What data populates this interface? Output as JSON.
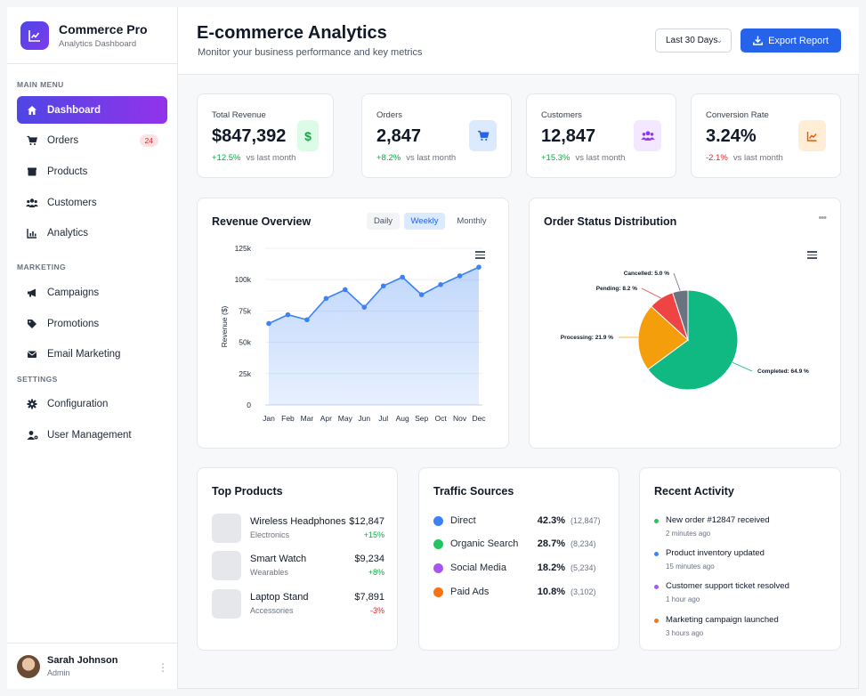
{
  "brand": {
    "title": "Commerce Pro",
    "subtitle": "Analytics Dashboard"
  },
  "sidebar": {
    "sections": [
      {
        "label": "MAIN MENU"
      },
      {
        "label": "MARKETING"
      },
      {
        "label": "SETTINGS"
      }
    ],
    "items": [
      {
        "label": "Dashboard",
        "icon": "home-icon",
        "active": true
      },
      {
        "label": "Orders",
        "icon": "cart-icon",
        "badge": "24"
      },
      {
        "label": "Products",
        "icon": "box-icon"
      },
      {
        "label": "Customers",
        "icon": "users-icon"
      },
      {
        "label": "Analytics",
        "icon": "chart-icon"
      },
      {
        "label": "Campaigns",
        "icon": "megaphone-icon"
      },
      {
        "label": "Promotions",
        "icon": "tags-icon"
      },
      {
        "label": "Email Marketing",
        "icon": "envelope-icon"
      },
      {
        "label": "Configuration",
        "icon": "gear-icon"
      },
      {
        "label": "User Management",
        "icon": "user-gear-icon"
      }
    ],
    "user": {
      "name": "Sarah Johnson",
      "role": "Admin"
    }
  },
  "header": {
    "title": "E-commerce Analytics",
    "subtitle": "Monitor your business performance and key metrics",
    "range": "Last 30 Days",
    "export_label": "Export Report"
  },
  "stats": [
    {
      "label": "Total Revenue",
      "value": "$847,392",
      "change": "+12.5%",
      "vs": "vs last month",
      "color": "#16a34a",
      "icon": "dollar-icon"
    },
    {
      "label": "Orders",
      "value": "2,847",
      "change": "+8.2%",
      "vs": "vs last month",
      "color": "#2563eb",
      "icon": "cart-icon"
    },
    {
      "label": "Customers",
      "value": "12,847",
      "change": "+15.3%",
      "vs": "vs last month",
      "color": "#9333ea",
      "icon": "users-icon"
    },
    {
      "label": "Conversion Rate",
      "value": "3.24%",
      "change": "-2.1%",
      "vs": "vs last month",
      "color": "#ea580c",
      "icon": "chart-line-icon"
    }
  ],
  "revenue": {
    "title": "Revenue Overview",
    "tabs": [
      "Daily",
      "Weekly",
      "Monthly"
    ],
    "active_tab": "Weekly"
  },
  "orders_status": {
    "title": "Order Status Distribution"
  },
  "top_products": {
    "title": "Top Products",
    "items": [
      {
        "name": "Wireless Headphones",
        "category": "Electronics",
        "price": "$12,847",
        "change": "+15%"
      },
      {
        "name": "Smart Watch",
        "category": "Wearables",
        "price": "$9,234",
        "change": "+8%"
      },
      {
        "name": "Laptop Stand",
        "category": "Accessories",
        "price": "$7,891",
        "change": "-3%"
      }
    ]
  },
  "traffic": {
    "title": "Traffic Sources",
    "items": [
      {
        "name": "Direct",
        "pct": "42.3%",
        "count": "(12,847)",
        "color": "#3b82f6"
      },
      {
        "name": "Organic Search",
        "pct": "28.7%",
        "count": "(8,234)",
        "color": "#22c55e"
      },
      {
        "name": "Social Media",
        "pct": "18.2%",
        "count": "(5,234)",
        "color": "#a855f7"
      },
      {
        "name": "Paid Ads",
        "pct": "10.8%",
        "count": "(3,102)",
        "color": "#f97316"
      }
    ]
  },
  "activity": {
    "title": "Recent Activity",
    "items": [
      {
        "text": "New order #12847 received",
        "time": "2 minutes ago",
        "color": "#22c55e"
      },
      {
        "text": "Product inventory updated",
        "time": "15 minutes ago",
        "color": "#3b82f6"
      },
      {
        "text": "Customer support ticket resolved",
        "time": "1 hour ago",
        "color": "#a855f7"
      },
      {
        "text": "Marketing campaign launched",
        "time": "3 hours ago",
        "color": "#f97316"
      }
    ]
  },
  "chart_data": [
    {
      "type": "area",
      "title": "",
      "xlabel": "",
      "ylabel": "Revenue ($)",
      "categories": [
        "Jan",
        "Feb",
        "Mar",
        "Apr",
        "May",
        "Jun",
        "Jul",
        "Aug",
        "Sep",
        "Oct",
        "Nov",
        "Dec"
      ],
      "values": [
        65000,
        72000,
        68000,
        85000,
        92000,
        78000,
        95000,
        102000,
        88000,
        96000,
        103000,
        110000
      ],
      "y_ticks": [
        "0",
        "25k",
        "50k",
        "75k",
        "100k",
        "125k"
      ],
      "ylim": [
        0,
        125000
      ],
      "grid": true,
      "color": "#3b82f6"
    },
    {
      "type": "pie",
      "slices": [
        {
          "label": "Completed: 64.9 %",
          "value": 64.9,
          "color": "#10b981"
        },
        {
          "label": "Processing: 21.9 %",
          "value": 21.9,
          "color": "#f59e0b"
        },
        {
          "label": "Pending: 8.2 %",
          "value": 8.2,
          "color": "#ef4444"
        },
        {
          "label": "Cancelled: 5.0 %",
          "value": 5.0,
          "color": "#6b7280"
        }
      ]
    }
  ]
}
